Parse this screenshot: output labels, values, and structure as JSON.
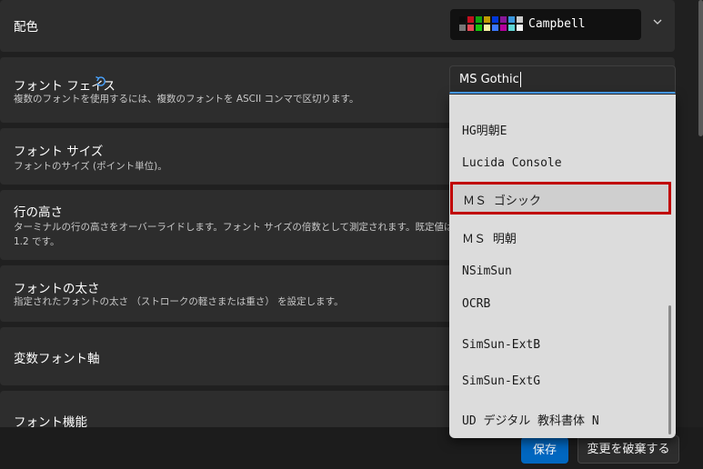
{
  "settings": {
    "color_scheme": {
      "title": "配色",
      "value": "Campbell"
    },
    "font_face": {
      "title": "フォント フェイス",
      "description": "複数のフォントを使用するには、複数のフォントを ASCII コンマで区切ります。",
      "value": "MS Gothic"
    },
    "font_size": {
      "title": "フォント サイズ",
      "description": "フォントのサイズ (ポイント単位)。"
    },
    "line_height": {
      "title": "行の高さ",
      "description_line1": "ターミナルの行の高さをオーバーライドします。フォント サイズの倍数として測定されます。既定値はフォント",
      "description_line2": "1.2 です。"
    },
    "font_weight": {
      "title": "フォントの太さ",
      "description": "指定されたフォントの太さ （ストロークの軽さまたは重さ） を設定します。"
    },
    "variable_font_axes": {
      "title": "変数フォント軸"
    },
    "font_features": {
      "title": "フォント機能"
    }
  },
  "font_list": {
    "items": [
      "HG明朝E",
      "Lucida Console",
      "ＭＳ ゴシック",
      "ＭＳ 明朝",
      "NSimSun",
      "OCRB",
      "SimSun-ExtB",
      "SimSun-ExtG",
      "UD デジタル 教科書体 N"
    ],
    "selected": "ＭＳ ゴシック"
  },
  "swatch_colors": [
    "#0c0c0c",
    "#c50f1f",
    "#13a10e",
    "#c19c00",
    "#0037da",
    "#881798",
    "#3a96dd",
    "#cccccc",
    "#767676",
    "#e74856",
    "#16c60c",
    "#f9f1a5",
    "#3b78ff",
    "#b4009e",
    "#61d6d6",
    "#f2f2f2"
  ],
  "icons": {
    "reset": "reset-icon",
    "chevron": "chevron-down-icon"
  },
  "footer": {
    "save_label": "保存",
    "discard_label": "変更を破棄する"
  },
  "accent": "#4aa3ff",
  "highlight": "#c00000"
}
